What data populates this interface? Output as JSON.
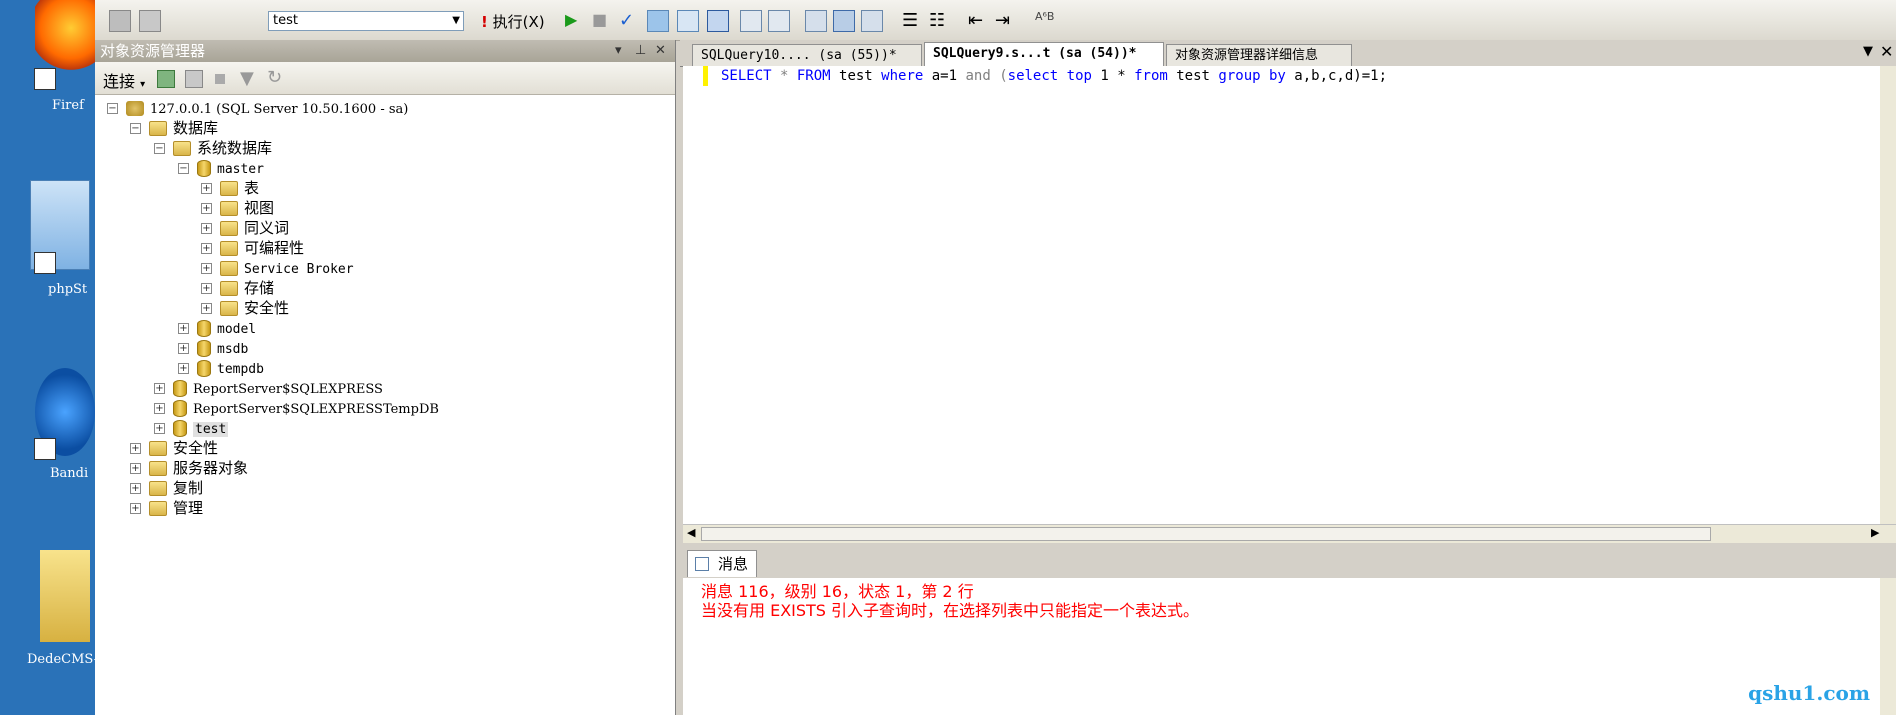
{
  "desktop": {
    "icons": [
      "Firef",
      "phpSt",
      "Bandi",
      "DedeCMS-V"
    ]
  },
  "toolbar": {
    "db_value": "test",
    "execute_label": "执行(X)"
  },
  "object_explorer": {
    "title": "对象资源管理器",
    "connect_label": "连接",
    "tree": {
      "server": "127.0.0.1 (SQL Server 10.50.1600 - sa)",
      "databases": "数据库",
      "system_databases": "系统数据库",
      "master": "master",
      "master_children": [
        "表",
        "视图",
        "同义词",
        "可编程性",
        "Service Broker",
        "存储",
        "安全性"
      ],
      "system_dbs": [
        "model",
        "msdb",
        "tempdb"
      ],
      "user_dbs": [
        "ReportServer$SQLEXPRESS",
        "ReportServer$SQLEXPRESSTempDB",
        "test"
      ],
      "top_level": [
        "安全性",
        "服务器对象",
        "复制",
        "管理"
      ]
    }
  },
  "editor": {
    "tabs": [
      "SQLQuery10.... (sa (55))*",
      "SQLQuery9.s...t (sa (54))*",
      "对象资源管理器详细信息"
    ],
    "active_tab": 1,
    "code": {
      "t1": "SELECT",
      "t2": " * ",
      "t3": "FROM",
      "t4": " test ",
      "t5": "where",
      "t6": " a=1 ",
      "t7": "and",
      "t8": " (",
      "t9": "select",
      "t10": " ",
      "t11": "top",
      "t12": " 1 * ",
      "t13": "from",
      "t14": " test ",
      "t15": "group",
      "t16": " ",
      "t17": "by",
      "t18": " a,b,c,d)=1;"
    }
  },
  "messages": {
    "tab_label": "消息",
    "line1": "消息 116，级别 16，状态 1，第 2 行",
    "line2": "当没有用 EXISTS 引入子查询时，在选择列表中只能指定一个表达式。"
  },
  "watermark": "qshu1.com",
  "colors": {
    "keyword": "#0000ff",
    "error": "#ff0000",
    "watermark": "#2aa3e6"
  }
}
